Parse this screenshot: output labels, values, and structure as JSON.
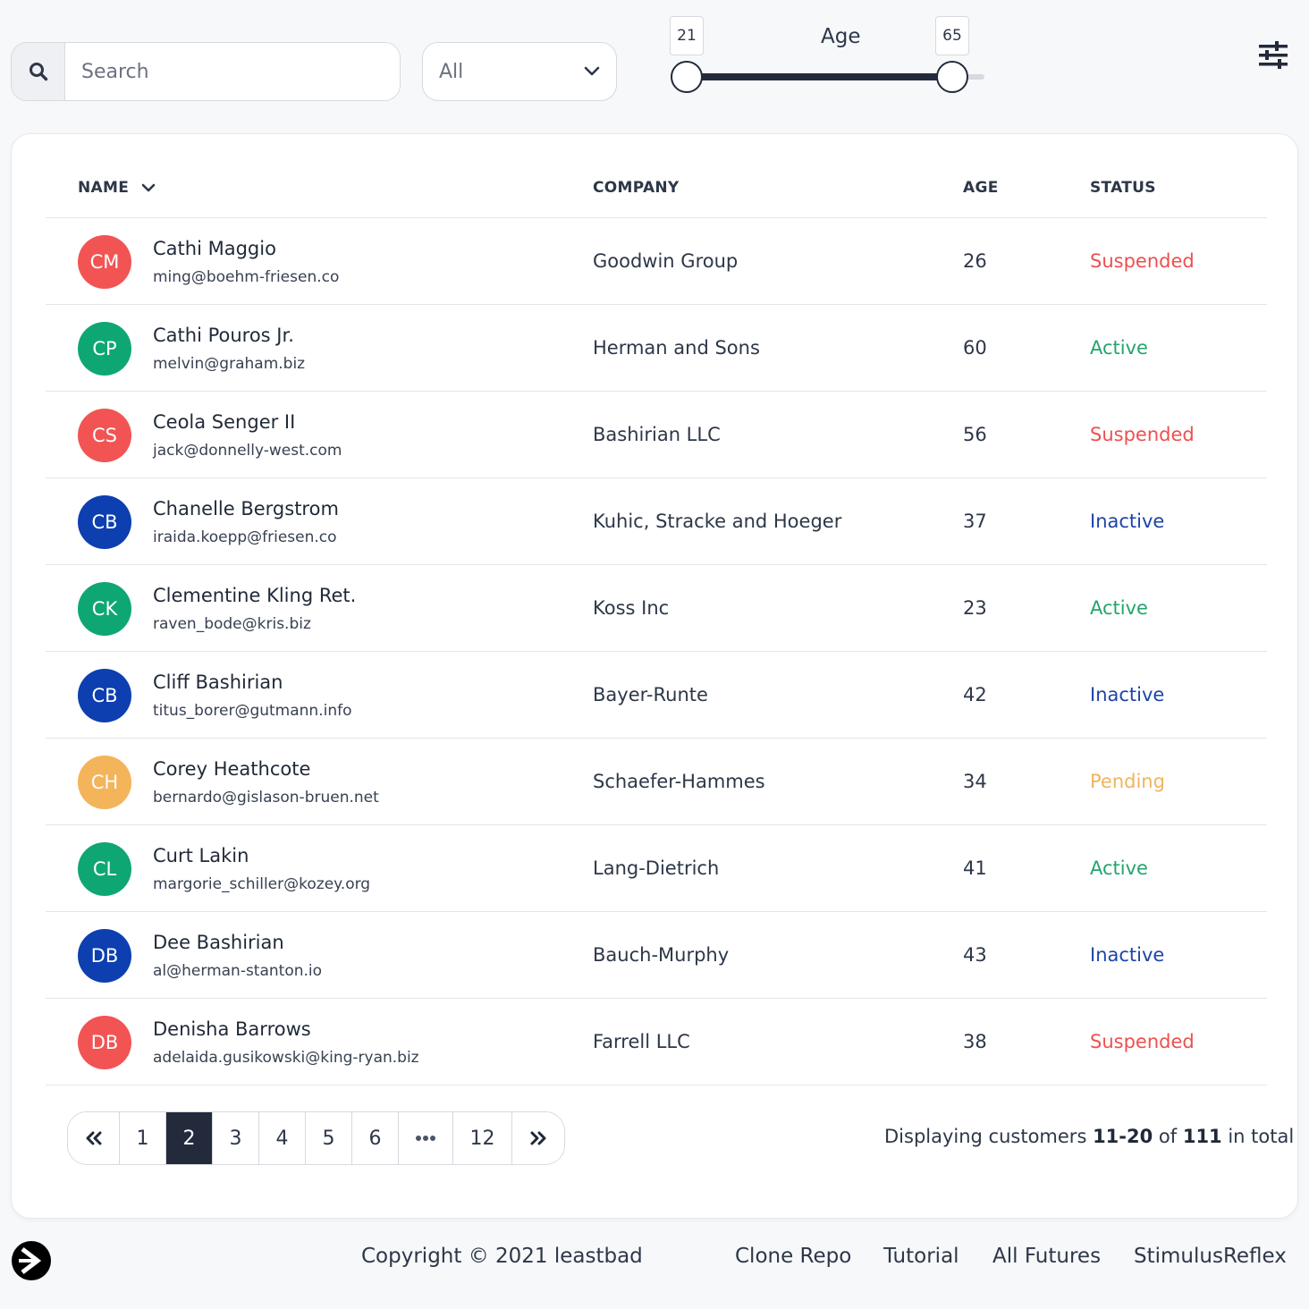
{
  "search": {
    "placeholder": "Search"
  },
  "filter": {
    "selected": "All"
  },
  "age_range": {
    "label": "Age",
    "min_value": "21",
    "max_value": "65"
  },
  "table": {
    "headers": {
      "name": "NAME",
      "company": "COMPANY",
      "age": "AGE",
      "status": "STATUS"
    },
    "rows": [
      {
        "initials": "CM",
        "avatar_color": "#f25454",
        "name": "Cathi Maggio",
        "email": "ming@boehm-friesen.co",
        "company": "Goodwin Group",
        "age": "26",
        "status": "Suspended",
        "status_color": "#ef4f4f"
      },
      {
        "initials": "CP",
        "avatar_color": "#0ea774",
        "name": "Cathi Pouros Jr.",
        "email": "melvin@graham.biz",
        "company": "Herman and Sons",
        "age": "60",
        "status": "Active",
        "status_color": "#24a46d"
      },
      {
        "initials": "CS",
        "avatar_color": "#f25454",
        "name": "Ceola Senger II",
        "email": "jack@donnelly-west.com",
        "company": "Bashirian LLC",
        "age": "56",
        "status": "Suspended",
        "status_color": "#ef4f4f"
      },
      {
        "initials": "CB",
        "avatar_color": "#0d3fb0",
        "name": "Chanelle Bergstrom",
        "email": "iraida.koepp@friesen.co",
        "company": "Kuhic, Stracke and Hoeger",
        "age": "37",
        "status": "Inactive",
        "status_color": "#1c44a8"
      },
      {
        "initials": "CK",
        "avatar_color": "#0ea774",
        "name": "Clementine Kling Ret.",
        "email": "raven_bode@kris.biz",
        "company": "Koss Inc",
        "age": "23",
        "status": "Active",
        "status_color": "#24a46d"
      },
      {
        "initials": "CB",
        "avatar_color": "#0d3fb0",
        "name": "Cliff Bashirian",
        "email": "titus_borer@gutmann.info",
        "company": "Bayer-Runte",
        "age": "42",
        "status": "Inactive",
        "status_color": "#1c44a8"
      },
      {
        "initials": "CH",
        "avatar_color": "#f4b45a",
        "name": "Corey Heathcote",
        "email": "bernardo@gislason-bruen.net",
        "company": "Schaefer-Hammes",
        "age": "34",
        "status": "Pending",
        "status_color": "#f2b35c"
      },
      {
        "initials": "CL",
        "avatar_color": "#0ea774",
        "name": "Curt Lakin",
        "email": "margorie_schiller@kozey.org",
        "company": "Lang-Dietrich",
        "age": "41",
        "status": "Active",
        "status_color": "#24a46d"
      },
      {
        "initials": "DB",
        "avatar_color": "#0d3fb0",
        "name": "Dee Bashirian",
        "email": "al@herman-stanton.io",
        "company": "Bauch-Murphy",
        "age": "43",
        "status": "Inactive",
        "status_color": "#1c44a8"
      },
      {
        "initials": "DB",
        "avatar_color": "#f25454",
        "name": "Denisha Barrows",
        "email": "adelaida.gusikowski@king-ryan.biz",
        "company": "Farrell LLC",
        "age": "38",
        "status": "Suspended",
        "status_color": "#ef4f4f"
      }
    ]
  },
  "pagination": {
    "pages": [
      "1",
      "2",
      "3",
      "4",
      "5",
      "6",
      "12"
    ],
    "current": "2"
  },
  "summary": {
    "prefix": "Displaying customers ",
    "range": "11-20",
    "middle": " of ",
    "total": "111",
    "suffix": " in total"
  },
  "footer": {
    "copyright": "Copyright © 2021 leastbad",
    "links": [
      "Clone Repo",
      "Tutorial",
      "All Futures",
      "StimulusReflex"
    ]
  },
  "colors": {
    "dark": "#232a3c",
    "border": "#d6d9df"
  }
}
